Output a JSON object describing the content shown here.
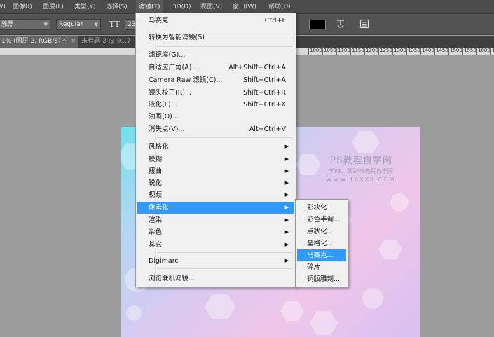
{
  "menubar": {
    "items": [
      "窗口(W)",
      "图像(I)",
      "图层(L)",
      "类型(Y)",
      "选择(S)",
      "滤镜(T)",
      "3D(D)",
      "视图(V)",
      "窗口(W)",
      "帮助(H)"
    ]
  },
  "options": {
    "font_family": "雅黑",
    "font_style": "Regular",
    "font_size_icon": "TT",
    "font_size": "23",
    "warp_icon": "warp-text-icon",
    "panels_icon": "character-panel-icon",
    "text_color": "#000000"
  },
  "tabs": [
    {
      "label": "1% (图层 2, RGB/8) *",
      "close": "×",
      "active": true
    },
    {
      "label": "未标题-2 @ 91.7",
      "close": "",
      "active": false
    }
  ],
  "ruler": {
    "ticks": [
      "1000",
      "1050",
      "1100",
      "1150",
      "1200",
      "1250",
      "1300",
      "1350",
      "1400",
      "1450",
      "1500",
      "1550",
      "1600",
      "1650"
    ]
  },
  "filter_menu": {
    "items": [
      {
        "label": "马赛克",
        "shortcut": "Ctrl+F"
      },
      {
        "label": "转换为智能滤镜(S)",
        "shortcut": ""
      },
      {
        "label": "滤镜库(G)...",
        "shortcut": ""
      },
      {
        "label": "自适应广角(A)...",
        "shortcut": "Alt+Shift+Ctrl+A"
      },
      {
        "label": "Camera Raw 滤镜(C)...",
        "shortcut": "Shift+Ctrl+A"
      },
      {
        "label": "镜头校正(R)...",
        "shortcut": "Shift+Ctrl+R"
      },
      {
        "label": "液化(L)...",
        "shortcut": "Shift+Ctrl+X"
      },
      {
        "label": "油画(O)...",
        "shortcut": ""
      },
      {
        "label": "消失点(V)...",
        "shortcut": "Alt+Ctrl+V"
      },
      {
        "label": "风格化",
        "arrow": "▶"
      },
      {
        "label": "模糊",
        "arrow": "▶"
      },
      {
        "label": "扭曲",
        "arrow": "▶"
      },
      {
        "label": "锐化",
        "arrow": "▶"
      },
      {
        "label": "视频",
        "arrow": "▶"
      },
      {
        "label": "像素化",
        "arrow": "▶"
      },
      {
        "label": "渲染",
        "arrow": "▶"
      },
      {
        "label": "杂色",
        "arrow": "▶"
      },
      {
        "label": "其它",
        "arrow": "▶"
      },
      {
        "label": "Digimarc",
        "arrow": "▶"
      },
      {
        "label": "浏览联机滤镜...",
        "shortcut": ""
      }
    ]
  },
  "pixelate_submenu": {
    "items": [
      "彩块化",
      "彩色半调...",
      "点状化...",
      "晶格化...",
      "马赛克...",
      "碎片",
      "铜版雕刻..."
    ]
  },
  "watermark": {
    "title": "PS教程自学网",
    "subtitle": "学PS，就到PS教程自学网",
    "url": "WWW.16XX8.COM"
  },
  "colors": {
    "highlight": "#3399ff",
    "menu_bg": "#f0f0f0",
    "app_bg": "#535353"
  }
}
